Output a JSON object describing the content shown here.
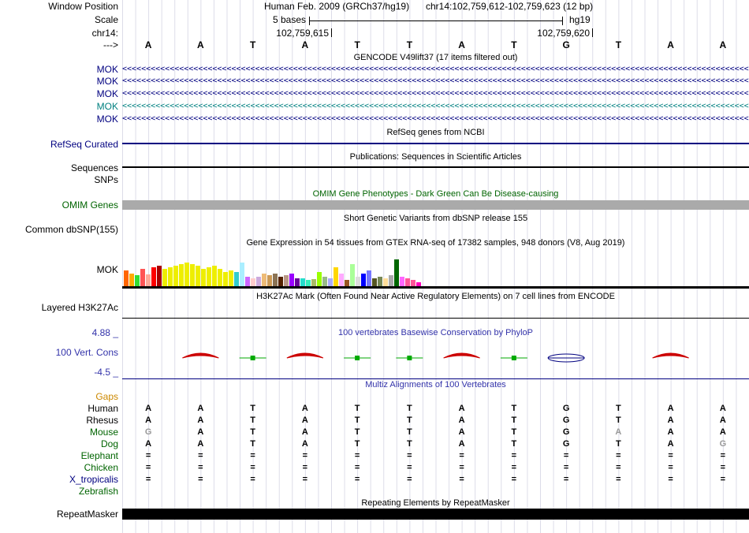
{
  "colors": {
    "navy": "#000080",
    "teal": "#008080",
    "omim_green": "#006400",
    "omim_bar": "#aaaaaa",
    "phylop_blue": "#3333aa",
    "multiz_blue": "#3333aa",
    "gaps_orange": "#cc8800",
    "dim_gray": "#999999",
    "grid": "#dcdce8",
    "red_mark": "#cc0000",
    "green_mark": "#00aa00"
  },
  "header": {
    "window_position_label": "Window Position",
    "assembly": "Human Feb. 2009 (GRCh37/hg19)",
    "position": "chr14:102,759,612-102,759,623 (12 bp)",
    "scale_label": "Scale",
    "scale_value": "5 bases",
    "assembly_short": "hg19",
    "chrom_label": "chr14:",
    "coord_left": "102,759,615",
    "coord_right": "102,759,620",
    "strand_label": "--->"
  },
  "bases": [
    "A",
    "A",
    "T",
    "A",
    "T",
    "T",
    "A",
    "T",
    "G",
    "T",
    "A",
    "A"
  ],
  "gencode": {
    "header": "GENCODE V49lift37 (17 items filtered out)",
    "arrow_char": "<",
    "items": [
      {
        "label": "MOK",
        "color": "#000080"
      },
      {
        "label": "MOK",
        "color": "#000080"
      },
      {
        "label": "MOK",
        "color": "#000080"
      },
      {
        "label": "MOK",
        "color": "#008080"
      },
      {
        "label": "MOK",
        "color": "#000080"
      }
    ]
  },
  "refseq": {
    "header": "RefSeq genes from NCBI",
    "label": "RefSeq Curated"
  },
  "publications": {
    "header": "Publications: Sequences in Scientific Articles",
    "label": "Sequences"
  },
  "snps_label": "SNPs",
  "omim": {
    "header": "OMIM Gene Phenotypes - Dark Green Can Be Disease-causing",
    "label": "OMIM Genes"
  },
  "dbsnp": {
    "header": "Short Genetic Variants from dbSNP release 155",
    "label": "Common dbSNP(155)"
  },
  "gtex": {
    "header": "Gene Expression in 54 tissues from GTEx RNA-seq of 17382 samples, 948 donors (V8, Aug 2019)",
    "label": "MOK",
    "bars": [
      [
        20,
        "#FF6600"
      ],
      [
        16,
        "#FFAA00"
      ],
      [
        14,
        "#33DD33"
      ],
      [
        22,
        "#FF5555"
      ],
      [
        15,
        "#FFAA99"
      ],
      [
        24,
        "#FF0000"
      ],
      [
        26,
        "#AA0000"
      ],
      [
        22,
        "#EEEE00"
      ],
      [
        24,
        "#EEEE00"
      ],
      [
        26,
        "#EEEE00"
      ],
      [
        28,
        "#EEEE00"
      ],
      [
        30,
        "#EEEE00"
      ],
      [
        28,
        "#EEEE00"
      ],
      [
        26,
        "#EEEE00"
      ],
      [
        22,
        "#EEEE00"
      ],
      [
        24,
        "#EEEE00"
      ],
      [
        26,
        "#EEEE00"
      ],
      [
        22,
        "#EEEE00"
      ],
      [
        18,
        "#EEEE00"
      ],
      [
        20,
        "#EEEE00"
      ],
      [
        18,
        "#33CCCC"
      ],
      [
        30,
        "#AAEEFF"
      ],
      [
        12,
        "#CC66FF"
      ],
      [
        10,
        "#FFCCCC"
      ],
      [
        12,
        "#CCAADD"
      ],
      [
        16,
        "#EEBB77"
      ],
      [
        14,
        "#CC9955"
      ],
      [
        16,
        "#8B7355"
      ],
      [
        12,
        "#552200"
      ],
      [
        14,
        "#BB9988"
      ],
      [
        16,
        "#9900FF"
      ],
      [
        10,
        "#660099"
      ],
      [
        10,
        "#22DDCC"
      ],
      [
        8,
        "#33EEBB"
      ],
      [
        9,
        "#AABB66"
      ],
      [
        18,
        "#99FF00"
      ],
      [
        12,
        "#99BB88"
      ],
      [
        10,
        "#AAAAFF"
      ],
      [
        24,
        "#FFD700"
      ],
      [
        16,
        "#FFAAFF"
      ],
      [
        8,
        "#995522"
      ],
      [
        28,
        "#AAFF99"
      ],
      [
        12,
        "#DDDDDD"
      ],
      [
        16,
        "#0000FF"
      ],
      [
        20,
        "#7777FF"
      ],
      [
        10,
        "#555522"
      ],
      [
        12,
        "#778855"
      ],
      [
        10,
        "#FFDD99"
      ],
      [
        14,
        "#AAAAAA"
      ],
      [
        34,
        "#006600"
      ],
      [
        12,
        "#FF66FF"
      ],
      [
        10,
        "#FF5599"
      ],
      [
        8,
        "#FF5599"
      ],
      [
        5,
        "#FF00BB"
      ]
    ]
  },
  "h3k27ac": {
    "header": "H3K27Ac Mark (Often Found Near Active Regulatory Elements) on 7 cell lines from ENCODE",
    "label": "Layered H3K27Ac"
  },
  "phylop": {
    "header": "100 vertebrates Basewise Conservation by PhyloP",
    "label": "100 Vert. Cons",
    "max_label": "4.88 _",
    "min_label": "-4.5 _",
    "red_arc_cols": [
      1,
      3,
      6,
      10
    ],
    "green_mark_cols": [
      2,
      4,
      5,
      7
    ],
    "blue_lens_cols": [
      8
    ]
  },
  "multiz": {
    "header": "Multiz Alignments of 100 Vertebrates",
    "rows": [
      {
        "label": "Gaps",
        "label_color": "#cc8800",
        "cells": [
          "",
          "",
          "",
          "",
          "",
          "",
          "",
          "",
          "",
          "",
          "",
          ""
        ],
        "gray": []
      },
      {
        "label": "Human",
        "label_color": "#000000",
        "cells": [
          "A",
          "A",
          "T",
          "A",
          "T",
          "T",
          "A",
          "T",
          "G",
          "T",
          "A",
          "A"
        ],
        "gray": []
      },
      {
        "label": "Rhesus",
        "label_color": "#000000",
        "cells": [
          "A",
          "A",
          "T",
          "A",
          "T",
          "T",
          "A",
          "T",
          "G",
          "T",
          "A",
          "A"
        ],
        "gray": []
      },
      {
        "label": "Mouse",
        "label_color": "#006400",
        "cells": [
          "G",
          "A",
          "T",
          "A",
          "T",
          "T",
          "A",
          "T",
          "G",
          "A",
          "A",
          "A"
        ],
        "gray": [
          0,
          9
        ]
      },
      {
        "label": "Dog",
        "label_color": "#006400",
        "cells": [
          "A",
          "A",
          "T",
          "A",
          "T",
          "T",
          "A",
          "T",
          "G",
          "T",
          "A",
          "G"
        ],
        "gray": [
          11
        ]
      },
      {
        "label": "Elephant",
        "label_color": "#006400",
        "cells": [
          "=",
          "=",
          "=",
          "=",
          "=",
          "=",
          "=",
          "=",
          "=",
          "=",
          "=",
          "="
        ],
        "gray": []
      },
      {
        "label": "Chicken",
        "label_color": "#006400",
        "cells": [
          "=",
          "=",
          "=",
          "=",
          "=",
          "=",
          "=",
          "=",
          "=",
          "=",
          "=",
          "="
        ],
        "gray": []
      },
      {
        "label": "X_tropicalis",
        "label_color": "#000080",
        "cells": [
          "=",
          "=",
          "=",
          "=",
          "=",
          "=",
          "=",
          "=",
          "=",
          "=",
          "=",
          "="
        ],
        "gray": []
      },
      {
        "label": "Zebrafish",
        "label_color": "#006400",
        "cells": [
          "",
          "",
          "",
          "",
          "",
          "",
          "",
          "",
          "",
          "",
          "",
          ""
        ],
        "gray": []
      }
    ]
  },
  "repeatmasker": {
    "header": "Repeating Elements by RepeatMasker",
    "label": "RepeatMasker"
  }
}
